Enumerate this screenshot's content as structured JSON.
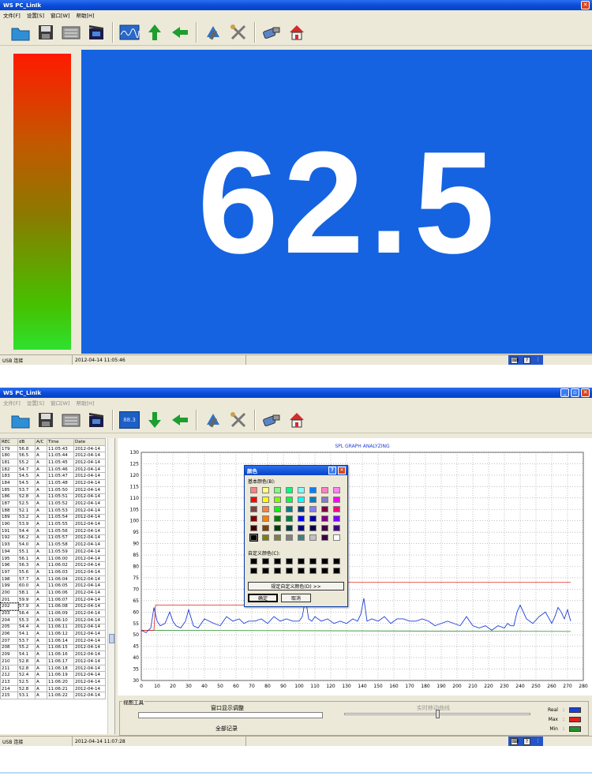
{
  "top_window": {
    "title": "WS PC_LinIk",
    "menu": [
      "文件[F]",
      "设置[S]",
      "窗口[W]",
      "帮助[H]"
    ],
    "toolbar_icons": [
      "folder-icon",
      "save-icon",
      "table-icon",
      "clapper-icon",
      "waveform-icon",
      "arrow-up-icon",
      "arrow-left-icon",
      "meter-icon",
      "tools-icon",
      "connect-icon",
      "home-icon"
    ],
    "reading": "62.5",
    "status": {
      "connection": "USB 连接",
      "timestamp": "2012-04-14  11:05:46"
    }
  },
  "bottom_window": {
    "title": "WS PC_LinIk",
    "menu": [
      "文件[F]",
      "设置[S]",
      "窗口[W]",
      "帮助[H]"
    ],
    "toolbar_icons": [
      "folder-icon",
      "save-icon",
      "table-icon",
      "clapper-icon",
      "lcd-display-icon",
      "arrow-down-icon",
      "arrow-left-icon",
      "meter-icon",
      "tools-icon",
      "connect-icon",
      "home-icon"
    ],
    "lcd_button_value": "88.3",
    "table": {
      "columns": [
        "REC",
        "dB",
        "A/C",
        "Time",
        "Date"
      ],
      "rows": [
        [
          "179",
          "56.8",
          "A",
          "11:05:43",
          "2012-04-14"
        ],
        [
          "180",
          "56.5",
          "A",
          "11:05:44",
          "2012-04-14"
        ],
        [
          "181",
          "55.2",
          "A",
          "11:05:45",
          "2012-04-14"
        ],
        [
          "182",
          "54.7",
          "A",
          "11:05:46",
          "2012-04-14"
        ],
        [
          "183",
          "54.5",
          "A",
          "11:05:47",
          "2012-04-14"
        ],
        [
          "184",
          "54.5",
          "A",
          "11:05:48",
          "2012-04-14"
        ],
        [
          "185",
          "53.7",
          "A",
          "11:05:50",
          "2012-04-14"
        ],
        [
          "186",
          "52.8",
          "A",
          "11:05:51",
          "2012-04-14"
        ],
        [
          "187",
          "52.5",
          "A",
          "11:05:52",
          "2012-04-14"
        ],
        [
          "188",
          "52.1",
          "A",
          "11:05:53",
          "2012-04-14"
        ],
        [
          "189",
          "53.2",
          "A",
          "11:05:54",
          "2012-04-14"
        ],
        [
          "190",
          "53.9",
          "A",
          "11:05:55",
          "2012-04-14"
        ],
        [
          "191",
          "54.4",
          "A",
          "11:05:56",
          "2012-04-14"
        ],
        [
          "192",
          "56.2",
          "A",
          "11:05:57",
          "2012-04-14"
        ],
        [
          "193",
          "54.0",
          "A",
          "11:05:58",
          "2012-04-14"
        ],
        [
          "194",
          "55.1",
          "A",
          "11:05:59",
          "2012-04-14"
        ],
        [
          "195",
          "56.1",
          "A",
          "11:06:00",
          "2012-04-14"
        ],
        [
          "196",
          "56.3",
          "A",
          "11:06:02",
          "2012-04-14"
        ],
        [
          "197",
          "55.6",
          "A",
          "11:06:03",
          "2012-04-14"
        ],
        [
          "198",
          "57.7",
          "A",
          "11:06:04",
          "2012-04-14"
        ],
        [
          "199",
          "60.0",
          "A",
          "11:06:05",
          "2012-04-14"
        ],
        [
          "200",
          "58.1",
          "A",
          "11:06:06",
          "2012-04-14"
        ],
        [
          "201",
          "59.9",
          "A",
          "11:06:07",
          "2012-04-14"
        ],
        [
          "202",
          "57.9",
          "A",
          "11:06:08",
          "2012-04-14"
        ],
        [
          "203",
          "56.4",
          "A",
          "11:06:09",
          "2012-04-14"
        ],
        [
          "204",
          "55.3",
          "A",
          "11:06:10",
          "2012-04-14"
        ],
        [
          "205",
          "54.4",
          "A",
          "11:06:11",
          "2012-04-14"
        ],
        [
          "206",
          "54.1",
          "A",
          "11:06:12",
          "2012-04-14"
        ],
        [
          "207",
          "53.7",
          "A",
          "11:06:14",
          "2012-04-14"
        ],
        [
          "208",
          "55.2",
          "A",
          "11:06:15",
          "2012-04-14"
        ],
        [
          "209",
          "54.1",
          "A",
          "11:06:16",
          "2012-04-14"
        ],
        [
          "210",
          "52.8",
          "A",
          "11:06:17",
          "2012-04-14"
        ],
        [
          "211",
          "52.8",
          "A",
          "11:06:18",
          "2012-04-14"
        ],
        [
          "212",
          "52.4",
          "A",
          "11:06:19",
          "2012-04-14"
        ],
        [
          "213",
          "52.5",
          "A",
          "11:06:20",
          "2012-04-14"
        ],
        [
          "214",
          "52.8",
          "A",
          "11:06:21",
          "2012-04-14"
        ],
        [
          "215",
          "53.1",
          "A",
          "11:06:22",
          "2012-04-14"
        ]
      ]
    },
    "panel_label": "视图工具",
    "window_adjust_label": "窗口显示调整",
    "realtime_label": "实时移动曲线",
    "all_records_label": "全部记录",
    "legend": [
      {
        "label": "Real",
        "color": "#1f3fd6"
      },
      {
        "label": "Max",
        "color": "#e0201a"
      },
      {
        "label": "Min",
        "color": "#2a8f2a"
      }
    ],
    "status": {
      "connection": "USB 连接",
      "timestamp": "2012-04-14  11:07:28"
    }
  },
  "chart_data": {
    "type": "line",
    "title": "SPL GRAPH ANALYZING",
    "xlim": [
      0,
      280
    ],
    "ylim": [
      30,
      130
    ],
    "grid": true,
    "x_ticks": [
      0,
      10,
      20,
      30,
      40,
      50,
      60,
      70,
      80,
      90,
      100,
      110,
      120,
      130,
      140,
      150,
      160,
      170,
      180,
      190,
      200,
      210,
      220,
      230,
      240,
      250,
      260,
      270,
      280
    ],
    "y_ticks": [
      30,
      35,
      40,
      45,
      50,
      55,
      60,
      65,
      70,
      75,
      80,
      85,
      90,
      95,
      100,
      105,
      110,
      115,
      120,
      125,
      130
    ],
    "series": [
      {
        "role": "real",
        "color": "#1f3fd6",
        "x": [
          0,
          3,
          6,
          8,
          10,
          12,
          15,
          18,
          20,
          22,
          25,
          28,
          30,
          33,
          36,
          40,
          43,
          46,
          50,
          54,
          58,
          62,
          65,
          68,
          72,
          76,
          80,
          84,
          88,
          92,
          96,
          100,
          102,
          104,
          106,
          108,
          110,
          114,
          118,
          122,
          126,
          130,
          134,
          137,
          139,
          141,
          143,
          146,
          150,
          154,
          158,
          162,
          166,
          170,
          174,
          178,
          182,
          186,
          190,
          194,
          198,
          202,
          206,
          210,
          214,
          218,
          222,
          226,
          230,
          232,
          234,
          236,
          238,
          240,
          244,
          248,
          252,
          256,
          260,
          262,
          264,
          266,
          268,
          270,
          272
        ],
        "y": [
          52,
          51,
          53,
          62,
          56,
          54,
          55,
          60,
          56,
          54,
          53,
          56,
          61,
          54,
          53,
          57,
          56,
          55,
          54,
          58,
          56,
          57,
          55,
          56,
          56,
          57,
          55,
          58,
          56,
          57,
          56,
          56,
          58,
          66,
          57,
          56,
          58,
          56,
          57,
          55,
          56,
          55,
          57,
          56,
          59,
          66,
          56,
          57,
          56,
          58,
          55,
          57,
          57,
          56,
          56,
          57,
          56,
          54,
          55,
          56,
          55,
          54,
          58,
          54,
          53,
          54,
          52,
          54,
          53,
          55,
          54,
          54,
          60,
          63,
          57,
          55,
          58,
          60,
          55,
          58,
          62,
          60,
          57,
          61,
          56
        ]
      },
      {
        "role": "max",
        "color": "#e0201a",
        "x": [
          0,
          8,
          9,
          104,
          105,
          272
        ],
        "y": [
          52,
          52,
          63,
          63,
          73,
          73
        ]
      },
      {
        "role": "min",
        "color": "#2a8f2a",
        "x": [
          0,
          272
        ],
        "y": [
          52,
          51.5
        ]
      }
    ]
  },
  "color_dialog": {
    "title": "颜色",
    "basic_colors_label": "基本颜色(B):",
    "custom_colors_label": "自定义颜色(C):",
    "define_custom_label": "规定自定义颜色(D) >>",
    "ok_label": "确定",
    "cancel_label": "取消",
    "basic_colors": [
      "#ff8080",
      "#ffff80",
      "#80ff80",
      "#00ff80",
      "#80ffff",
      "#0080ff",
      "#ff80c0",
      "#ff80ff",
      "#ff0000",
      "#ffff00",
      "#80ff00",
      "#00ff40",
      "#00ffff",
      "#0080c0",
      "#8080c0",
      "#ff00ff",
      "#804040",
      "#ff8040",
      "#00ff00",
      "#008080",
      "#004080",
      "#8080ff",
      "#800040",
      "#ff0080",
      "#800000",
      "#ff8000",
      "#008000",
      "#008040",
      "#0000ff",
      "#0000a0",
      "#800080",
      "#8000ff",
      "#400000",
      "#804000",
      "#004000",
      "#004040",
      "#000080",
      "#000040",
      "#400040",
      "#400080",
      "#000000",
      "#808000",
      "#808040",
      "#808080",
      "#408080",
      "#c0c0c0",
      "#400040",
      "#ffffff"
    ]
  }
}
